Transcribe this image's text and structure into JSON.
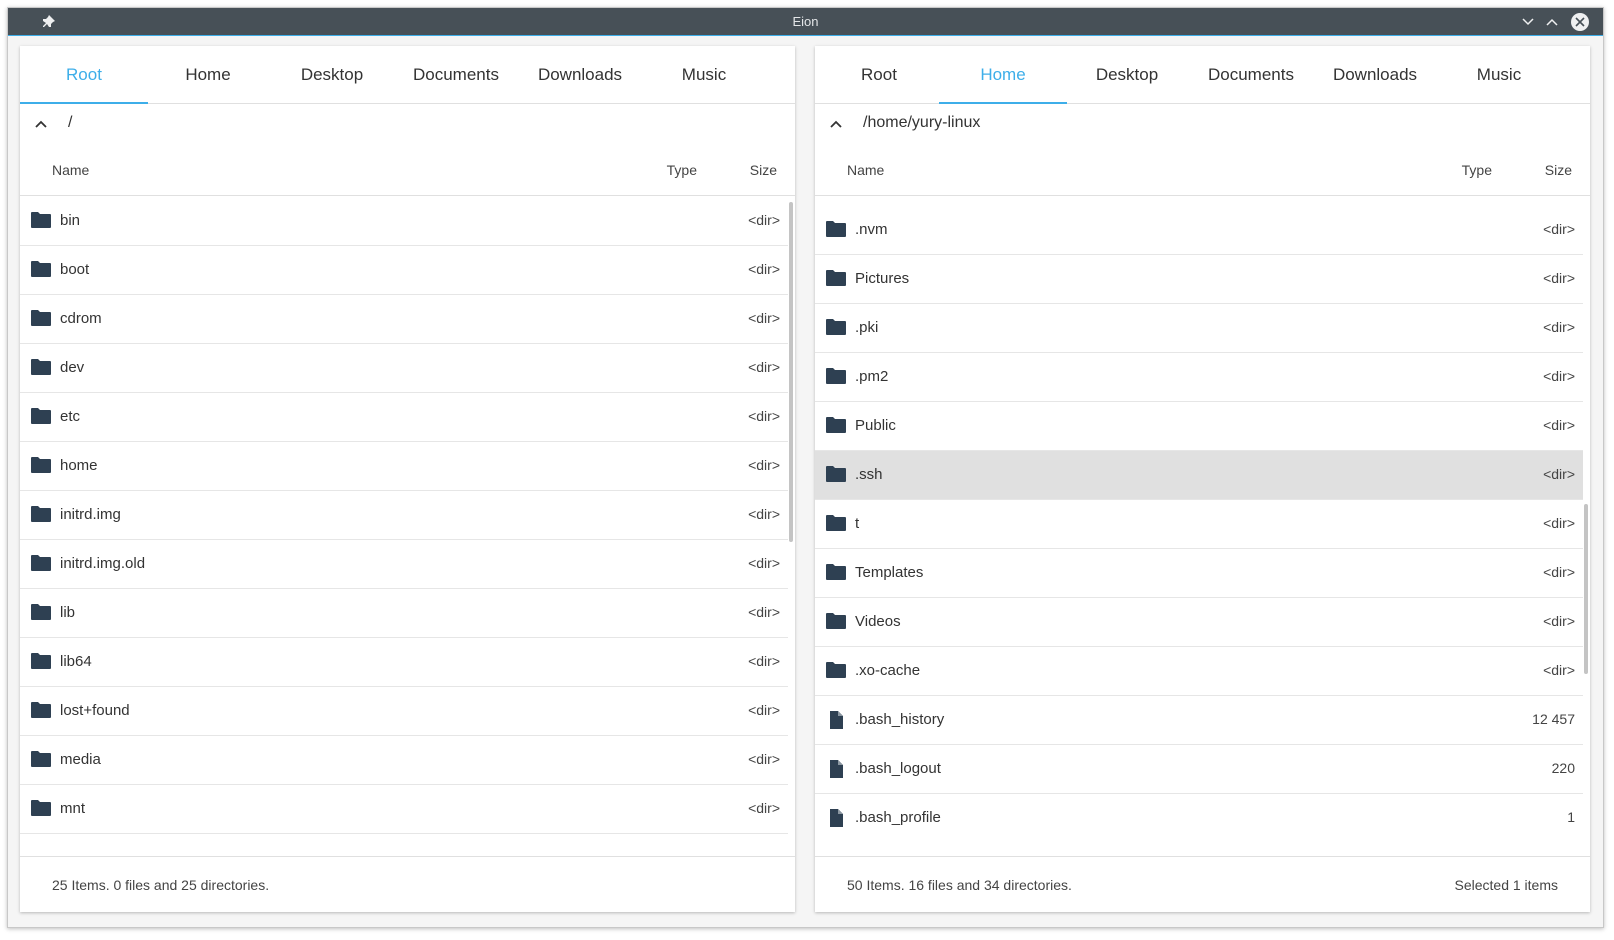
{
  "window": {
    "title": "Eion",
    "pin_icon": "pin-icon",
    "minimize_icon": "chevron-down-icon",
    "maximize_icon": "chevron-up-icon",
    "close_icon": "close-icon"
  },
  "colors": {
    "accent": "#3daee9",
    "titlebar": "#475057",
    "folder": "#2e4052",
    "selected_row": "#e0e0e0"
  },
  "left_pane": {
    "tabs": [
      {
        "label": "Root",
        "active": true
      },
      {
        "label": "Home",
        "active": false
      },
      {
        "label": "Desktop",
        "active": false
      },
      {
        "label": "Documents",
        "active": false
      },
      {
        "label": "Downloads",
        "active": false
      },
      {
        "label": "Music",
        "active": false
      }
    ],
    "path": "/",
    "columns": {
      "name": "Name",
      "type": "Type",
      "size": "Size"
    },
    "rows": [
      {
        "name": "bin",
        "size": "<dir>",
        "kind": "folder"
      },
      {
        "name": "boot",
        "size": "<dir>",
        "kind": "folder"
      },
      {
        "name": "cdrom",
        "size": "<dir>",
        "kind": "folder"
      },
      {
        "name": "dev",
        "size": "<dir>",
        "kind": "folder"
      },
      {
        "name": "etc",
        "size": "<dir>",
        "kind": "folder"
      },
      {
        "name": "home",
        "size": "<dir>",
        "kind": "folder"
      },
      {
        "name": "initrd.img",
        "size": "<dir>",
        "kind": "folder"
      },
      {
        "name": "initrd.img.old",
        "size": "<dir>",
        "kind": "folder"
      },
      {
        "name": "lib",
        "size": "<dir>",
        "kind": "folder"
      },
      {
        "name": "lib64",
        "size": "<dir>",
        "kind": "folder"
      },
      {
        "name": "lost+found",
        "size": "<dir>",
        "kind": "folder"
      },
      {
        "name": "media",
        "size": "<dir>",
        "kind": "folder"
      },
      {
        "name": "mnt",
        "size": "<dir>",
        "kind": "folder"
      },
      {
        "name": "",
        "size": "",
        "kind": "folder"
      }
    ],
    "status": {
      "summary": "25 Items. 0 files and 25 directories.",
      "selected": ""
    }
  },
  "right_pane": {
    "tabs": [
      {
        "label": "Root",
        "active": false
      },
      {
        "label": "Home",
        "active": true
      },
      {
        "label": "Desktop",
        "active": false
      },
      {
        "label": "Documents",
        "active": false
      },
      {
        "label": "Downloads",
        "active": false
      },
      {
        "label": "Music",
        "active": false
      }
    ],
    "path": "/home/yury-linux",
    "columns": {
      "name": "Name",
      "type": "Type",
      "size": "Size"
    },
    "rows": [
      {
        "name": ".nvm",
        "size": "<dir>",
        "kind": "folder"
      },
      {
        "name": "Pictures",
        "size": "<dir>",
        "kind": "folder"
      },
      {
        "name": ".pki",
        "size": "<dir>",
        "kind": "folder"
      },
      {
        "name": ".pm2",
        "size": "<dir>",
        "kind": "folder"
      },
      {
        "name": "Public",
        "size": "<dir>",
        "kind": "folder"
      },
      {
        "name": ".ssh",
        "size": "<dir>",
        "kind": "folder",
        "selected": true
      },
      {
        "name": "t",
        "size": "<dir>",
        "kind": "folder"
      },
      {
        "name": "Templates",
        "size": "<dir>",
        "kind": "folder"
      },
      {
        "name": "Videos",
        "size": "<dir>",
        "kind": "folder"
      },
      {
        "name": ".xo-cache",
        "size": "<dir>",
        "kind": "folder"
      },
      {
        "name": ".bash_history",
        "size": "12 457",
        "kind": "file"
      },
      {
        "name": ".bash_logout",
        "size": "220",
        "kind": "file"
      },
      {
        "name": ".bash_profile",
        "size": "1",
        "kind": "file"
      }
    ],
    "status": {
      "summary": "50 Items. 16 files and 34 directories.",
      "selected": "Selected 1 items"
    }
  }
}
